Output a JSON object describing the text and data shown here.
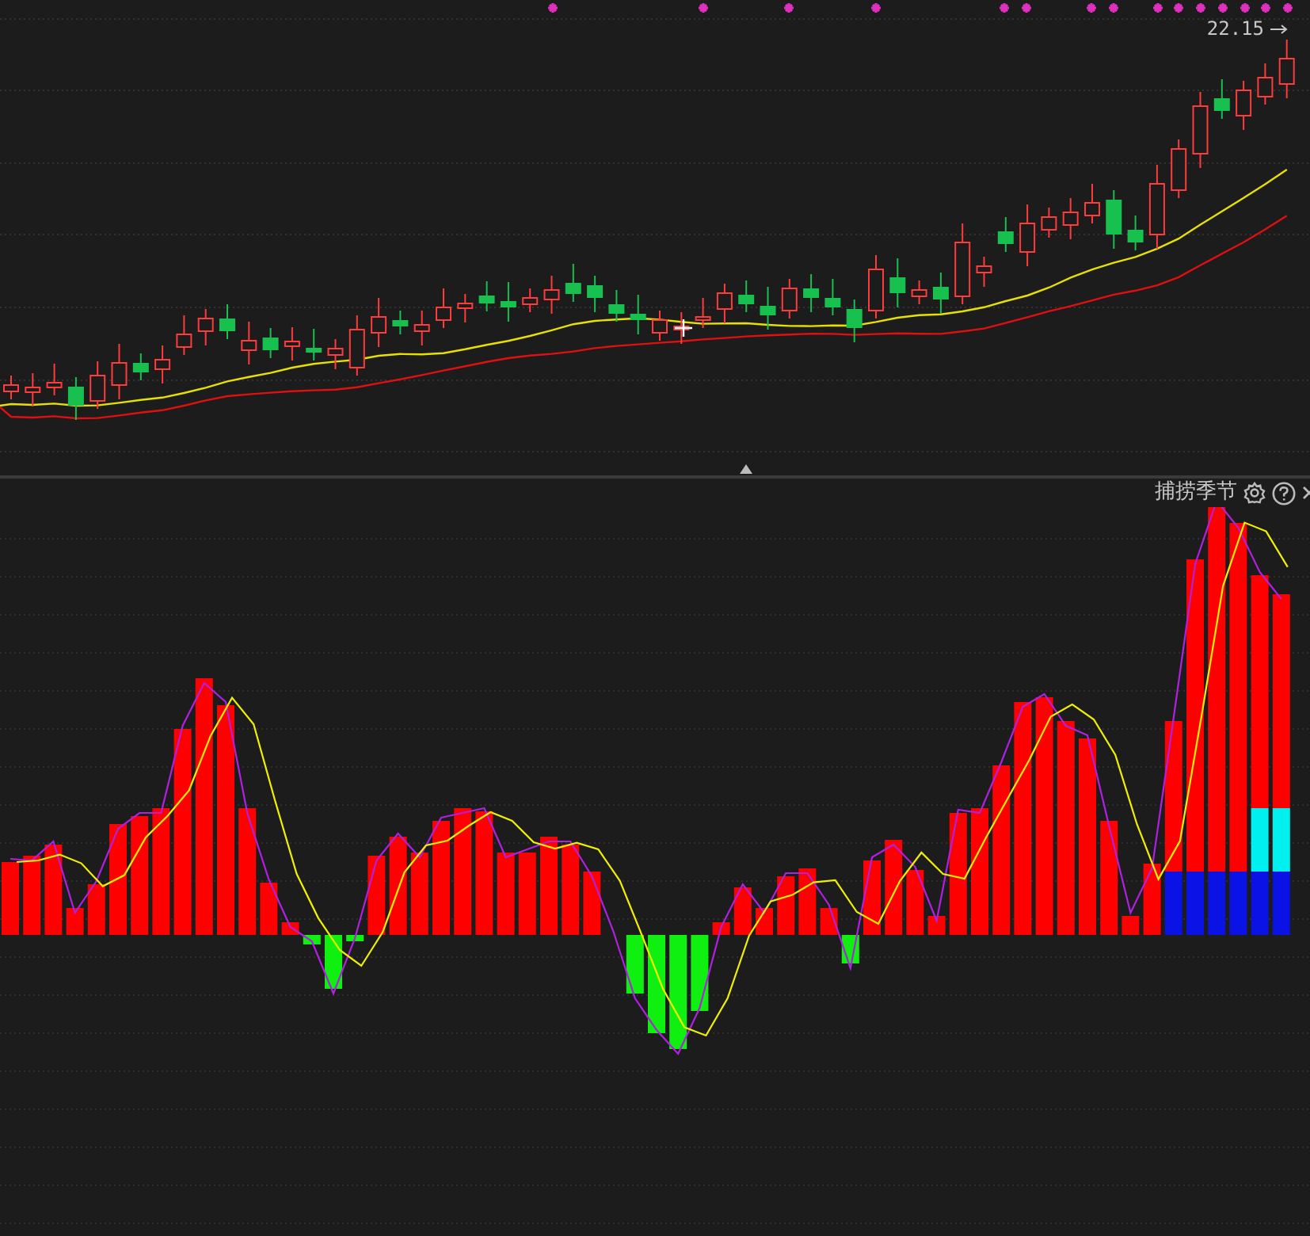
{
  "price_chart": {
    "high_label": "22.15"
  },
  "indicator": {
    "title": "捕捞季节"
  }
}
